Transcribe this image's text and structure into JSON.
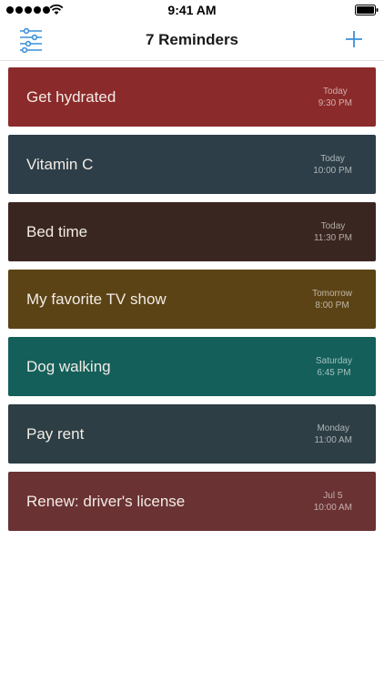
{
  "status_bar": {
    "time": "9:41 AM"
  },
  "nav": {
    "title": "7 Reminders",
    "left_icon": "sliders-icon",
    "right_icon": "plus-icon",
    "accent_color": "#3b8fd9"
  },
  "reminders": [
    {
      "title": "Get hydrated",
      "day": "Today",
      "time": "9:30 PM",
      "color": "#8b2a2a"
    },
    {
      "title": "Vitamin C",
      "day": "Today",
      "time": "10:00 PM",
      "color": "#2d3e48"
    },
    {
      "title": "Bed time",
      "day": "Today",
      "time": "11:30 PM",
      "color": "#3a2620"
    },
    {
      "title": "My favorite TV show",
      "day": "Tomorrow",
      "time": "8:00 PM",
      "color": "#5b4315"
    },
    {
      "title": "Dog walking",
      "day": "Saturday",
      "time": "6:45 PM",
      "color": "#145f5a"
    },
    {
      "title": "Pay rent",
      "day": "Monday",
      "time": "11:00 AM",
      "color": "#2d3e44"
    },
    {
      "title": "Renew: driver's license",
      "day": "Jul 5",
      "time": "10:00 AM",
      "color": "#6a3233"
    }
  ]
}
